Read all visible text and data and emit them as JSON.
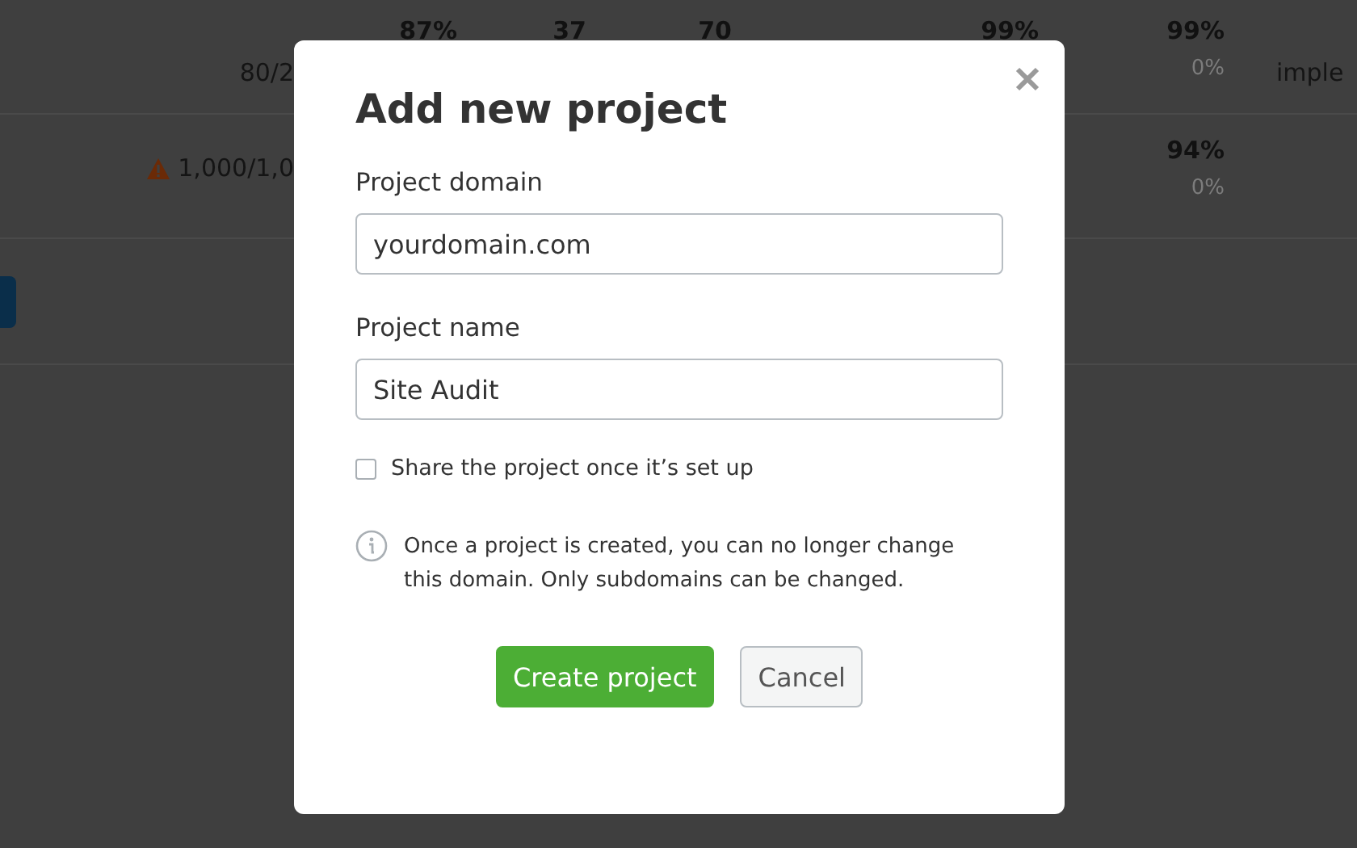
{
  "background_table": {
    "rows": [
      {
        "warning": false,
        "column_1": {
          "value": "80/2"
        },
        "column_2": {
          "value": "87%"
        },
        "column_3": {
          "value": "37"
        },
        "column_4": {
          "value": "70"
        },
        "column_5": {
          "value": "99%"
        },
        "column_6": {
          "value": "99%",
          "sub": "0%"
        },
        "column_7": {
          "value": "imple"
        }
      },
      {
        "warning": true,
        "column_1": {
          "value": "1,000/1,0"
        },
        "column_6": {
          "value": "94%",
          "sub": "0%"
        }
      }
    ]
  },
  "modal": {
    "title": "Add new project",
    "fields": [
      {
        "label": "Project domain",
        "value": "yourdomain.com"
      },
      {
        "label": "Project name",
        "value": "Site Audit"
      }
    ],
    "share": {
      "label": "Share the project once it’s set up",
      "checked": false
    },
    "note": "Once a project is created, you can no longer change this domain. Only subdomains can be changed.",
    "buttons": [
      {
        "label": "Create project",
        "kind": "primary"
      },
      {
        "label": "Cancel",
        "kind": "secondary"
      }
    ]
  }
}
